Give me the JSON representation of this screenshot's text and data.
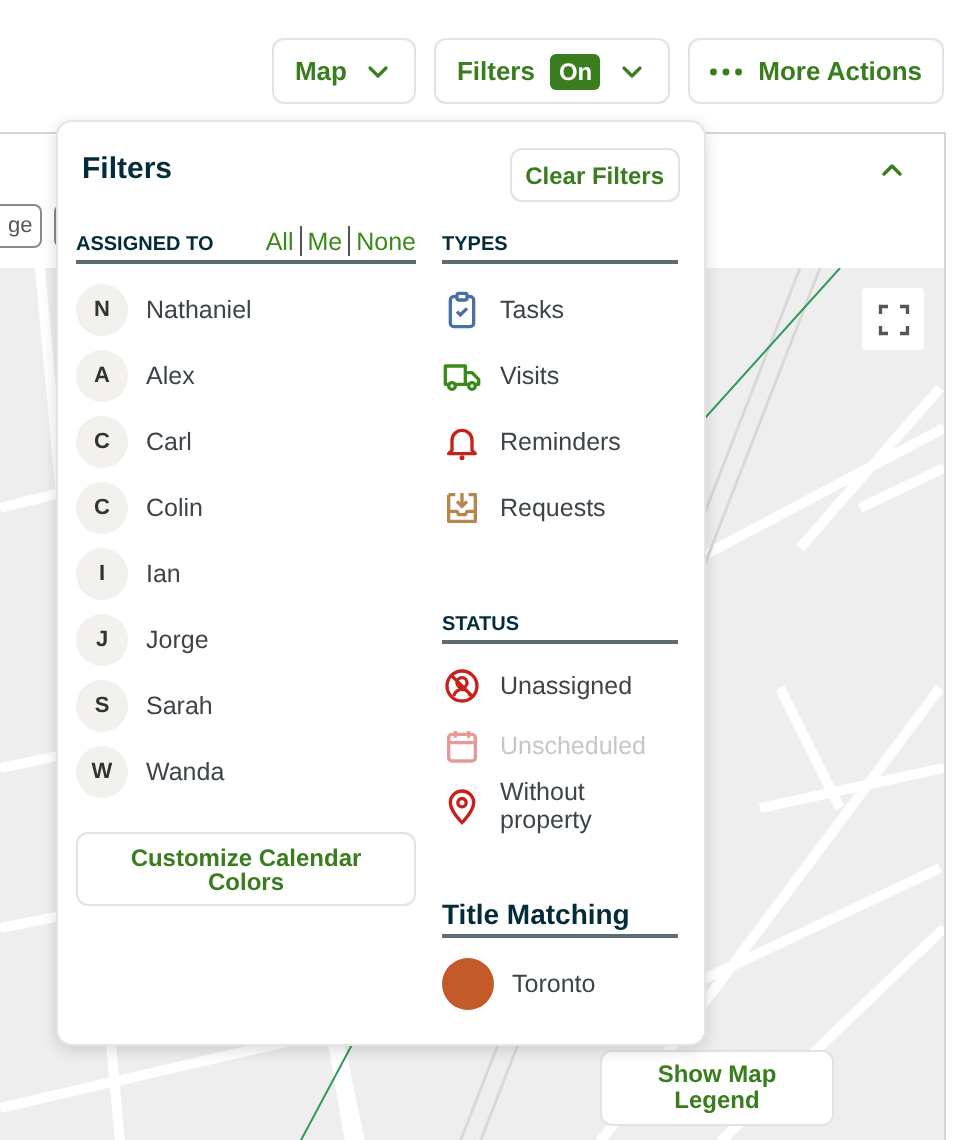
{
  "toolbar": {
    "view_button": {
      "label": "Map"
    },
    "filters_button": {
      "label": "Filters",
      "badge": "On"
    },
    "more_button": {
      "label": "More Actions"
    }
  },
  "map_panel": {
    "left_controls": [
      {
        "label": "ge"
      }
    ]
  },
  "filters": {
    "title": "Filters",
    "clear_button": "Clear Filters",
    "assigned_to": {
      "heading": "ASSIGNED TO",
      "links": [
        "All",
        "Me",
        "None"
      ],
      "people": [
        {
          "initial": "N",
          "name": "Nathaniel"
        },
        {
          "initial": "A",
          "name": "Alex"
        },
        {
          "initial": "C",
          "name": "Carl"
        },
        {
          "initial": "C",
          "name": "Colin"
        },
        {
          "initial": "I",
          "name": "Ian"
        },
        {
          "initial": "J",
          "name": "Jorge"
        },
        {
          "initial": "S",
          "name": "Sarah"
        },
        {
          "initial": "W",
          "name": "Wanda"
        }
      ]
    },
    "customize_button": "Customize Calendar Colors",
    "types": {
      "heading": "TYPES",
      "items": [
        {
          "kind": "task",
          "label": "Tasks"
        },
        {
          "kind": "visit",
          "label": "Visits"
        },
        {
          "kind": "reminder",
          "label": "Reminders"
        },
        {
          "kind": "request",
          "label": "Requests"
        }
      ]
    },
    "status": {
      "heading": "STATUS",
      "items": [
        {
          "kind": "unassigned",
          "label": "Unassigned",
          "disabled": false
        },
        {
          "kind": "unscheduled",
          "label": "Unscheduled",
          "disabled": true
        },
        {
          "kind": "no_property",
          "label": "Without property",
          "disabled": false
        }
      ]
    },
    "title_matching": {
      "heading": "Title Matching",
      "items": [
        {
          "label": "Toronto",
          "color": "#c35a2a"
        }
      ]
    }
  },
  "legend_button": "Show Map Legend"
}
